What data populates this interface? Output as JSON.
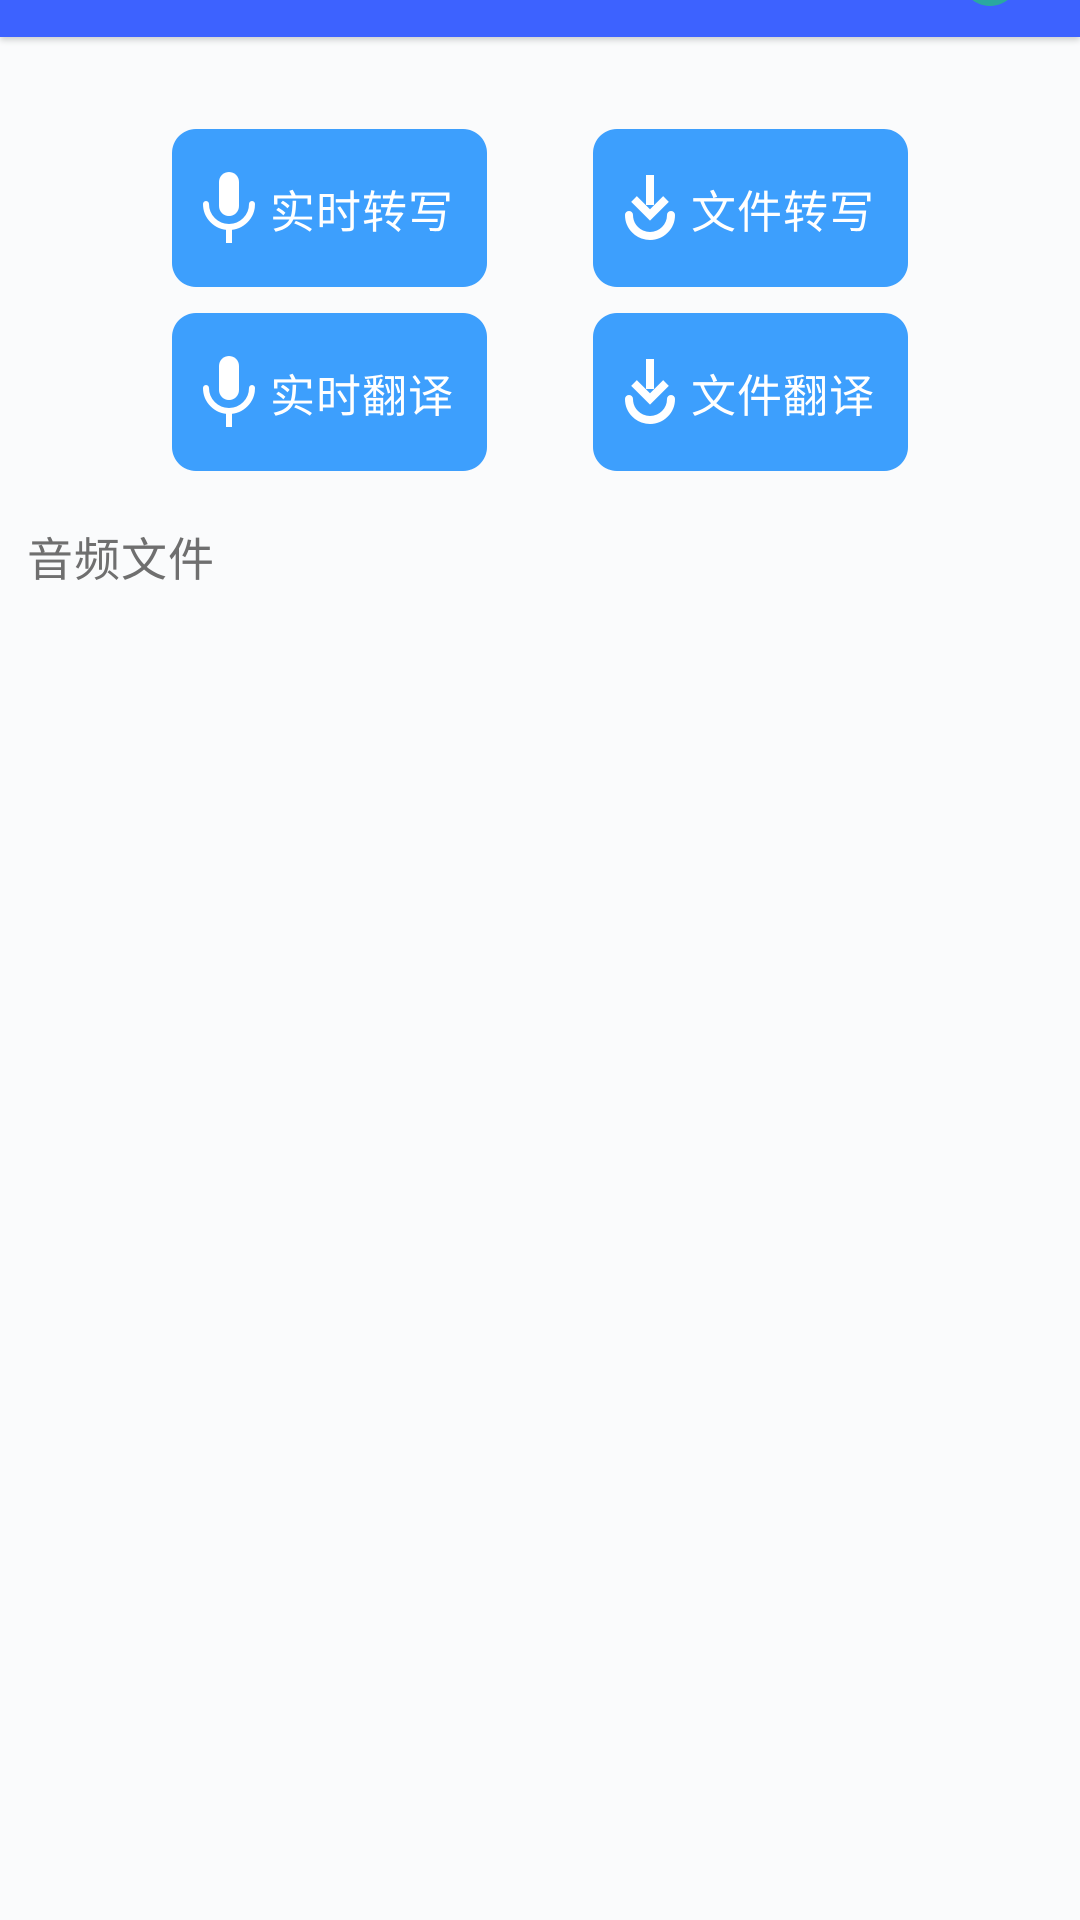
{
  "app_bar": {
    "accent_color": "#3d62ff",
    "avatar_color": "#2aa9a0"
  },
  "buttons": [
    {
      "label": "实时转写",
      "icon": "microphone-icon"
    },
    {
      "label": "文件转写",
      "icon": "download-icon"
    },
    {
      "label": "实时翻译",
      "icon": "microphone-icon"
    },
    {
      "label": "文件翻译",
      "icon": "download-icon"
    }
  ],
  "button_color": "#3d9ffd",
  "section": {
    "title": "音频文件"
  }
}
